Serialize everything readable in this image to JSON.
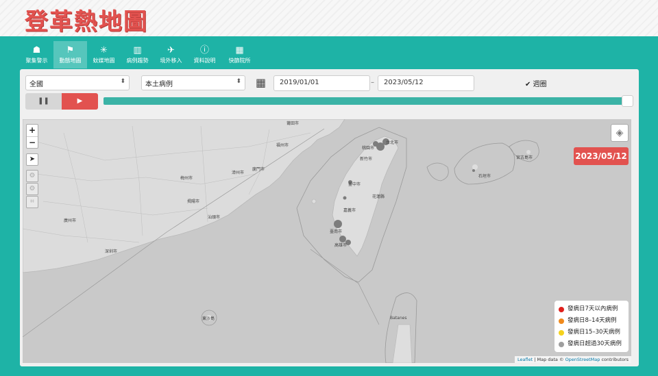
{
  "app": {
    "title": "登革熱地圖"
  },
  "nav": {
    "items": [
      {
        "label": "聚集警示",
        "icon": "group-icon",
        "glyph": "☗"
      },
      {
        "label": "動態地圖",
        "icon": "flag-icon",
        "glyph": "⚑"
      },
      {
        "label": "蚊媒地圖",
        "icon": "mosquito-icon",
        "glyph": "✳"
      },
      {
        "label": "病例趨勢",
        "icon": "chart-icon",
        "glyph": "▥"
      },
      {
        "label": "境外移入",
        "icon": "plane-icon",
        "glyph": "✈"
      },
      {
        "label": "資料說明",
        "icon": "info-icon",
        "glyph": "ⓘ"
      },
      {
        "label": "快篩院所",
        "icon": "hospital-icon",
        "glyph": "▦"
      }
    ],
    "active": "動態地圖"
  },
  "filters": {
    "region": "全國",
    "case_type": "本土病例",
    "start_date": "2019/01/01",
    "separator": "–",
    "end_date": "2023/05/12",
    "checkbox_label": "週圈",
    "checkbox_checked": true
  },
  "playback": {
    "pause_symbol": "❚❚",
    "play_symbol": "▶",
    "progress": 1.0
  },
  "map": {
    "zoom_in": "+",
    "zoom_out": "−",
    "current_date": "2023/05/12",
    "labels": {
      "fuzhou": "福州市",
      "xiamen": "廈門市",
      "taipei": "台北市",
      "taoyuan": "桃園市",
      "hsinchu": "新竹市",
      "taichung": "臺中市",
      "chiayi": "嘉義市",
      "tainan": "臺南市",
      "kaohsiung": "高雄市",
      "hualien": "花蓮縣",
      "guangzhou": "廣州市",
      "shenzhen": "深圳市",
      "shantou": "汕頭市",
      "jieyang": "揭陽市",
      "meizhou": "梅州市",
      "zhangzhou": "漳州市",
      "putian": "莆田市",
      "ishigaki": "石垣市",
      "miyako": "宮古島市",
      "pratas": "東沙島",
      "batanes": "Batanes"
    }
  },
  "legend": {
    "items": [
      {
        "label": "發病日7天以內病例",
        "color": "#e0201c"
      },
      {
        "label": "發病日8–14天病例",
        "color": "#f08a1c"
      },
      {
        "label": "發病日15–30天病例",
        "color": "#f5d21c"
      },
      {
        "label": "發病日超過30天病例",
        "color": "#9e9e9e"
      }
    ]
  },
  "attribution": {
    "leaflet": "Leaflet",
    "text": " | Map data © ",
    "osm": "OpenStreetMap",
    "suffix": " contributors"
  },
  "colors": {
    "teal": "#1eb3a6",
    "red": "#e2524f",
    "slider": "#3bb3a6"
  }
}
